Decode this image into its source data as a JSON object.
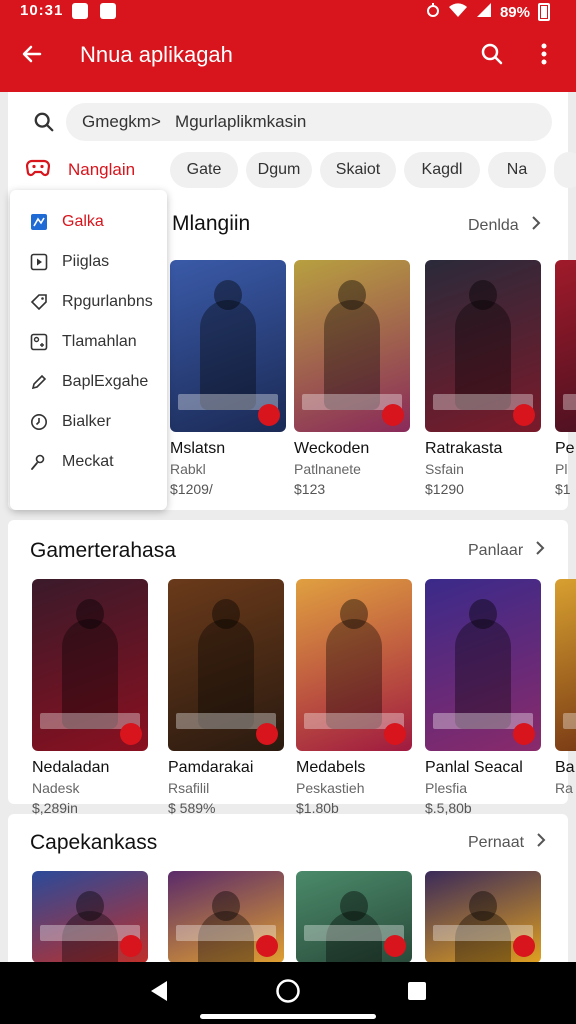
{
  "status": {
    "time": "10:31",
    "battery": "89%"
  },
  "appbar": {
    "title": "Nnua aplikagah"
  },
  "search": {
    "text": "Gmegkm>   Mgurlaplikmkasin"
  },
  "chips": {
    "main": "Nanglain",
    "items": [
      "Gate",
      "Dgum",
      "Skaiot",
      "Kagdl",
      "Na"
    ]
  },
  "menu": {
    "items": [
      {
        "label": "Galka",
        "icon": "game-icon"
      },
      {
        "label": "Piiglas",
        "icon": "play-square-icon"
      },
      {
        "label": "Rpgurlanbns",
        "icon": "tag-icon"
      },
      {
        "label": "Tlamahlan",
        "icon": "puzzle-icon"
      },
      {
        "label": "BaplExgahe",
        "icon": "pen-icon"
      },
      {
        "label": "Bialker",
        "icon": "clock-icon"
      },
      {
        "label": "Meckat",
        "icon": "person-icon"
      }
    ]
  },
  "sections": [
    {
      "title": "Mlangiin",
      "more": "Denlda",
      "cards": [
        {
          "name": "Mslatsn",
          "category": "Rabkl",
          "price": "$1209/",
          "colors": [
            "#3a5aa8",
            "#1b2a55"
          ]
        },
        {
          "name": "Weckoden",
          "category": "Patlnanete",
          "price": "$123",
          "colors": [
            "#b8a040",
            "#8a2a5a"
          ]
        },
        {
          "name": "Ratrakasta",
          "category": "Ssfain",
          "price": "$1290",
          "colors": [
            "#2a2a3a",
            "#7a1a2a"
          ]
        },
        {
          "name": "Pe",
          "category": "Pl",
          "price": "$1",
          "colors": [
            "#a01a2a",
            "#401020"
          ]
        }
      ]
    },
    {
      "title": "Gamerterahasa",
      "more": "Panlaar",
      "cards": [
        {
          "name": "Nedaladan",
          "category": "Nadesk",
          "price": "$,289in",
          "colors": [
            "#3a1a2a",
            "#8a1020"
          ]
        },
        {
          "name": "Pamdarakai",
          "category": "Rsafilil",
          "price": "$ 589%",
          "colors": [
            "#6a3a1a",
            "#2a1a10"
          ]
        },
        {
          "name": "Medabels",
          "category": "Peskastieh",
          "price": "$1.80b",
          "colors": [
            "#e0a040",
            "#a01a40"
          ]
        },
        {
          "name": "Panlal Seacal",
          "category": "Plesfia",
          "price": "$.5,80b",
          "colors": [
            "#3a2a8a",
            "#8a2a6a"
          ]
        },
        {
          "name": "Ba",
          "category": "Ra",
          "price": "",
          "colors": [
            "#d8a030",
            "#6a2a10"
          ]
        }
      ]
    },
    {
      "title": "Capekankass",
      "more": "Pernaat",
      "cards": [
        {
          "colors": [
            "#2a4a9a",
            "#c0302a"
          ]
        },
        {
          "colors": [
            "#5a2a6a",
            "#e0a030"
          ]
        },
        {
          "colors": [
            "#4a8a6a",
            "#2a4a3a"
          ]
        },
        {
          "colors": [
            "#3a2a5a",
            "#e0a020"
          ]
        }
      ]
    }
  ]
}
